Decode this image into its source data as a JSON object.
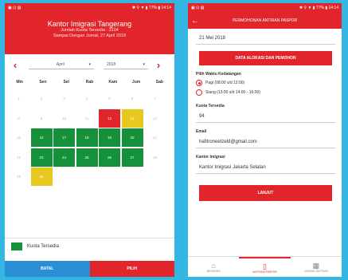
{
  "calendar_screen": {
    "status_left": "▣ ⊡ ▤",
    "status_right": "✱ ⚲ ▼ ▮ 77% ▮ 14:14",
    "title": "Kantor Imigrasi Tangerang",
    "quota_line": "Jumlah Kuota Tersedia : 3104",
    "until_line": "Sampai Dengan Jumat, 27 April 2018",
    "prev_icon": "chevron-left-icon",
    "next_icon": "chevron-right-icon",
    "month_value": "April",
    "year_value": "2018",
    "weekdays": [
      "Min",
      "Sen",
      "Sel",
      "Rab",
      "Kam",
      "Jum",
      "Sab"
    ],
    "cells": [
      {
        "d": "1",
        "s": "n"
      },
      {
        "d": "2",
        "s": "n"
      },
      {
        "d": "3",
        "s": "n"
      },
      {
        "d": "4",
        "s": "n"
      },
      {
        "d": "5",
        "s": "n"
      },
      {
        "d": "6",
        "s": "n"
      },
      {
        "d": "7",
        "s": "n"
      },
      {
        "d": "8",
        "s": "n"
      },
      {
        "d": "9",
        "s": "n"
      },
      {
        "d": "10",
        "s": "n"
      },
      {
        "d": "11",
        "s": "n"
      },
      {
        "d": "12",
        "s": "r"
      },
      {
        "d": "13",
        "s": "y"
      },
      {
        "d": "14",
        "s": "n"
      },
      {
        "d": "15",
        "s": "n"
      },
      {
        "d": "16",
        "s": "g"
      },
      {
        "d": "17",
        "s": "g"
      },
      {
        "d": "18",
        "s": "g"
      },
      {
        "d": "19",
        "s": "g"
      },
      {
        "d": "20",
        "s": "g"
      },
      {
        "d": "21",
        "s": "n"
      },
      {
        "d": "22",
        "s": "n"
      },
      {
        "d": "23",
        "s": "g"
      },
      {
        "d": "24",
        "s": "g"
      },
      {
        "d": "25",
        "s": "g"
      },
      {
        "d": "26",
        "s": "g"
      },
      {
        "d": "27",
        "s": "g"
      },
      {
        "d": "28",
        "s": "n"
      },
      {
        "d": "29",
        "s": "n"
      },
      {
        "d": "30",
        "s": "y"
      }
    ],
    "legend_label": "Kuota Tersedia",
    "cancel_label": "BATAL",
    "select_label": "PILIH",
    "colors": {
      "green": "#14913a",
      "red": "#e1252b",
      "yellow": "#e6c81e",
      "blue": "#2b8fd6"
    }
  },
  "form_screen": {
    "status_left": "▣ ⊡ ▤",
    "status_right": "✱ ⚲ ▼ ▮ 77% ▮ 14:14",
    "back_icon": "arrow-left-icon",
    "title": "PERMOHONAN ANTRIAN PASPOR",
    "date_value": "21 Mei 2018",
    "applicant_button": "DATA ALOKASI DAN PEMOHON",
    "time_label": "Pilih Waktu Kedatangan",
    "option_morning": "Pagi (08:00 s/d 12:00)",
    "option_afternoon": "Siang (13:00 s/d 14:00 - 16:00)",
    "quota_label": "Kuota Tersedia",
    "quota_value": "94",
    "email_label": "Email",
    "email_value": "hafitroneetzeld@gmail.com",
    "office_label": "Kantor Imigrasi",
    "office_value": "Kantor Imigrasi Jakarta Selatan",
    "next_button": "LANJUT",
    "nav_items": [
      {
        "label": "BERANDA",
        "icon": "home-icon"
      },
      {
        "label": "ANTRIAN PASPOR",
        "icon": "document-icon"
      },
      {
        "label": "JADWAL ANTRIAN",
        "icon": "calendar-icon"
      }
    ]
  }
}
